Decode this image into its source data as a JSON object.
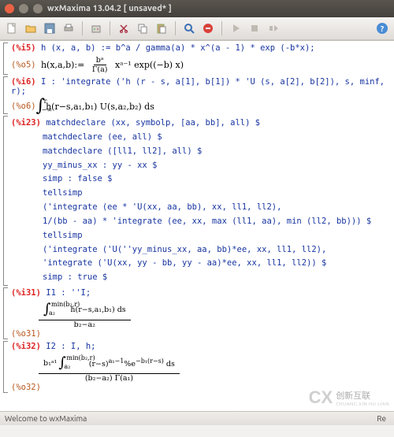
{
  "window": {
    "title": "wxMaxima 13.04.2 [ unsaved* ]"
  },
  "icons": {
    "close": "close-icon",
    "min": "minimize-icon",
    "max": "maximize-icon",
    "new": "new-doc-icon",
    "open": "open-icon",
    "save": "save-icon",
    "print": "print-icon",
    "config": "config-icon",
    "cut": "cut-icon",
    "copy": "copy-icon",
    "paste": "paste-icon",
    "find": "find-icon",
    "stop": "stop-icon",
    "run": "run-icon",
    "step": "step-icon",
    "anim": "anim-icon",
    "help": "help-icon"
  },
  "cell1": {
    "in_label": "(%i5)",
    "in_code": "h (x, a, b) := b^a / gamma(a) * x^(a - 1) * exp (-b*x);",
    "out_label": "(%o5)",
    "out_math_lhs": "h(x,a,b):=",
    "frac_num": "bᵃ",
    "frac_den": "Γ(a)",
    "out_math_rhs": "xᵃ⁻¹ exp((−b) x)"
  },
  "cell2": {
    "in_label": "(%i6)",
    "in_code": "I : 'integrate ('h (r - s, a[1], b[1]) * 'U (s, a[2], b[2]), s, minf, r);",
    "out_label": "(%o6)",
    "int_up": "r",
    "int_lo": "−∞",
    "integrand": "h(r−s,a₁,b₁) U(s,a₂,b₂) ds"
  },
  "cell3": {
    "in_label": "(%i23)",
    "lines": [
      "matchdeclare (xx, symbolp, [aa, bb], all) $",
      "matchdeclare (ee, all) $",
      "matchdeclare ([ll1, ll2], all) $",
      "yy_minus_xx : yy - xx $",
      "simp : false $",
      "tellsimp",
      "('integrate (ee * 'U(xx, aa, bb), xx, ll1, ll2),",
      "1/(bb - aa) * 'integrate (ee, xx, max (ll1, aa), min (ll2, bb))) $",
      "tellsimp",
      "('integrate ('U(''yy_minus_xx, aa, bb)*ee, xx, ll1, ll2),",
      "'integrate ('U(xx, yy - bb, yy - aa)*ee, xx, ll1, ll2)) $",
      "simp : true $"
    ]
  },
  "cell4": {
    "in_label": "(%i31)",
    "in_code": "I1 : ''I;",
    "out_label": "(%o31)",
    "int_up": "min(b₂,r)",
    "int_lo": "a₂",
    "integrand": "h(r−s,a₁,b₁) ds",
    "denom": "b₂−a₂"
  },
  "cell5": {
    "in_label": "(%i32)",
    "in_code": "I2 : I, h;",
    "out_label": "(%o32)",
    "coef": "b₁ᵃ¹",
    "int_up": "min(b₂,r)",
    "int_lo": "a₂",
    "integrand_a": "(r−s)",
    "integrand_exp": "a₁−1",
    "integrand_b": "%e",
    "integrand_bexp": "−b₁(r−s)",
    "integrand_c": " ds",
    "denom": "(b₂−a₂) Γ(a₁)"
  },
  "status": {
    "left": "Welcome to wxMaxima",
    "right": "Re"
  },
  "watermark": {
    "logo": "CX",
    "line1": "创新互联",
    "line2": "CHUANG XIN HU LIAN"
  }
}
